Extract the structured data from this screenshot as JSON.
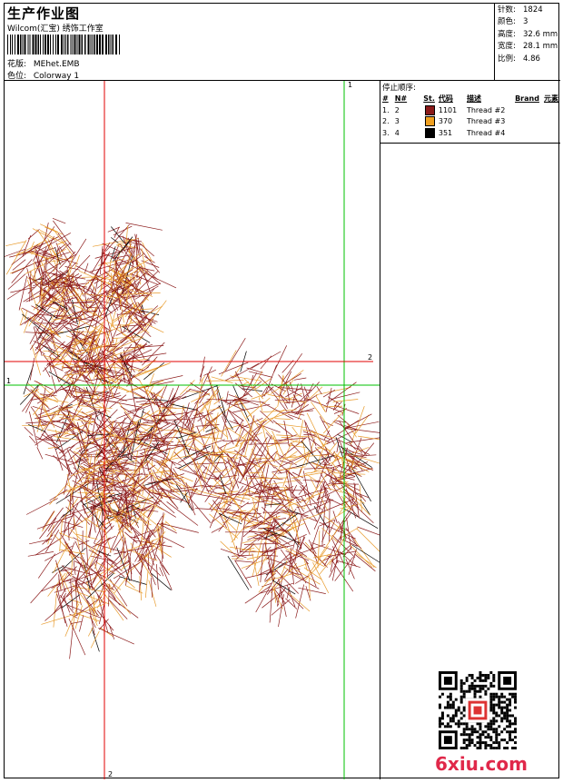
{
  "header": {
    "title": "生产作业图",
    "subtitle": "Wilcom(汇宝) 绣饰工作室",
    "design_label": "花版:",
    "design_value": "MEhet.EMB",
    "colorway_label": "色位:",
    "colorway_value": "Colorway 1"
  },
  "stats": [
    {
      "label": "针数:",
      "value": "1824"
    },
    {
      "label": "颜色:",
      "value": "3"
    },
    {
      "label": "高度:",
      "value": "32.6 mm"
    },
    {
      "label": "宽度:",
      "value": "28.1 mm"
    },
    {
      "label": "比例:",
      "value": "4.86"
    }
  ],
  "stop_sequence": {
    "heading": "停止顺序:",
    "columns": [
      "#",
      "N#",
      "St.",
      "代码",
      "描述",
      "Brand",
      "元素"
    ],
    "rows": [
      {
        "index": "1.",
        "n": "2",
        "code": "1101",
        "desc": "Thread #2",
        "color": "#8b1a1a"
      },
      {
        "index": "2.",
        "n": "3",
        "code": "370",
        "desc": "Thread #3",
        "color": "#f0a020"
      },
      {
        "index": "3.",
        "n": "4",
        "code": "351",
        "desc": "Thread #4",
        "color": "#000000"
      }
    ]
  },
  "guides": {
    "vertical_red": "2",
    "vertical_green": "1",
    "horizontal_red": "2",
    "horizontal_green": "1"
  },
  "colors": {
    "red_guide": "#e00000",
    "green_guide": "#00c000",
    "thread_dark": "#8b1a1a",
    "thread_orange": "#e89a2a"
  },
  "watermark": {
    "logo_text": "6xiu.com"
  }
}
